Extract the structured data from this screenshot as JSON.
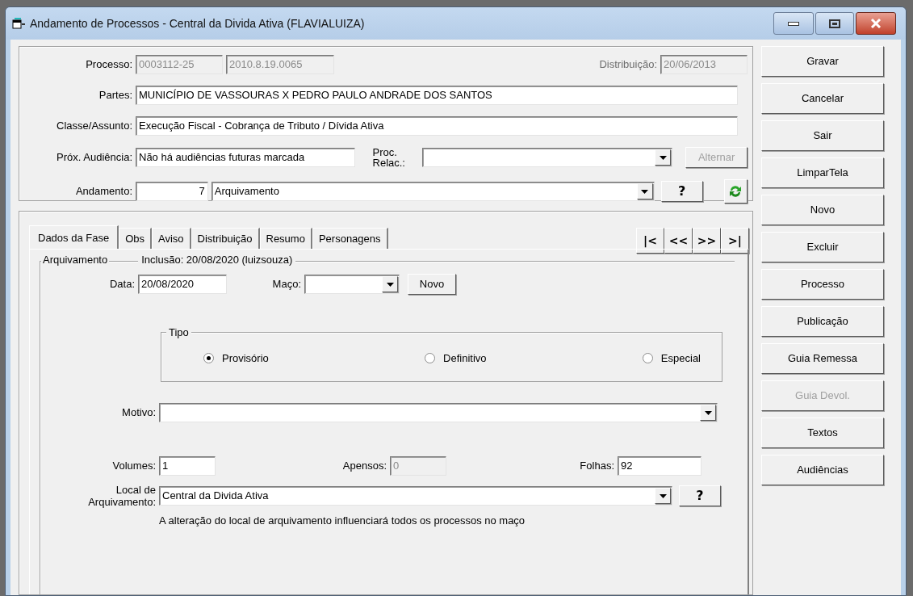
{
  "window": {
    "title": "Andamento de Processos - Central da Divida Ativa (FLAVIALUIZA)"
  },
  "header": {
    "processo": {
      "label": "Processo:",
      "values": [
        "0003112-25",
        "2010.8.19.0065"
      ],
      "disabled": true
    },
    "distribuicao": {
      "label": "Distribuição:",
      "value": "20/06/2013",
      "disabled": true
    },
    "partes": {
      "label": "Partes:",
      "value": "MUNICÍPIO DE VASSOURAS X PEDRO PAULO ANDRADE DOS SANTOS"
    },
    "classe": {
      "label": "Classe/Assunto:",
      "value": "Execução Fiscal - Cobrança de Tributo / Dívida Ativa"
    },
    "proxima_audiencia": {
      "label": "Próx. Audiência:",
      "value": "Não há audiências futuras marcada"
    },
    "proc_relac": {
      "label_lines": [
        "Proc.",
        "Relac.:"
      ]
    },
    "alternar": {
      "label": "Alternar",
      "disabled": true
    },
    "andamento": {
      "label": "Andamento:",
      "code": "7",
      "value": "Arquivamento"
    },
    "help_button": "?"
  },
  "tabs": [
    {
      "label": "Dados da Fase",
      "selected": true
    },
    {
      "label": "Obs",
      "selected": false
    },
    {
      "label": "Aviso",
      "selected": false
    },
    {
      "label": "Distribuição",
      "selected": false
    },
    {
      "label": "Resumo",
      "selected": false
    },
    {
      "label": "Personagens",
      "selected": false
    }
  ],
  "nav_buttons": [
    "|<",
    "<<",
    ">>",
    ">|"
  ],
  "fase": {
    "title": "Arquivamento",
    "inclusao": "Inclusão: 20/08/2020 (luizsouza)",
    "data": {
      "label": "Data:",
      "value": "20/08/2020"
    },
    "maco": {
      "label": "Maço:"
    },
    "novo_button": "Novo",
    "tipo": {
      "title": "Tipo",
      "options": [
        {
          "label": "Provisório",
          "selected": true
        },
        {
          "label": "Definitivo",
          "selected": false
        },
        {
          "label": "Especial",
          "selected": false
        }
      ]
    },
    "motivo": {
      "label": "Motivo:"
    },
    "volumes": {
      "label": "Volumes:",
      "value": "1",
      "disabled": false
    },
    "apensos": {
      "label": "Apensos:",
      "value": "0",
      "disabled": true
    },
    "folhas": {
      "label": "Folhas:",
      "value": "92",
      "disabled": false
    },
    "local": {
      "label_lines": [
        "Local de",
        "Arquivamento:"
      ],
      "value": "Central da Divida Ativa",
      "help_button": "?"
    },
    "note": "A alteração do local de arquivamento influenciará todos os processos no maço"
  },
  "side_buttons": [
    {
      "label": "Gravar",
      "disabled": false
    },
    {
      "label": "Cancelar",
      "disabled": false
    },
    {
      "label": "Sair",
      "disabled": false
    },
    {
      "label": "LimparTela",
      "disabled": false
    },
    {
      "label": "Novo",
      "disabled": false
    },
    {
      "label": "Excluir",
      "disabled": false
    },
    {
      "label": "Processo",
      "disabled": false
    },
    {
      "label": "Publicação",
      "disabled": false
    },
    {
      "label": "Guia Remessa",
      "disabled": false
    },
    {
      "label": "Guia Devol.",
      "disabled": true
    },
    {
      "label": "Textos",
      "disabled": false
    },
    {
      "label": "Audiências",
      "disabled": false
    }
  ]
}
